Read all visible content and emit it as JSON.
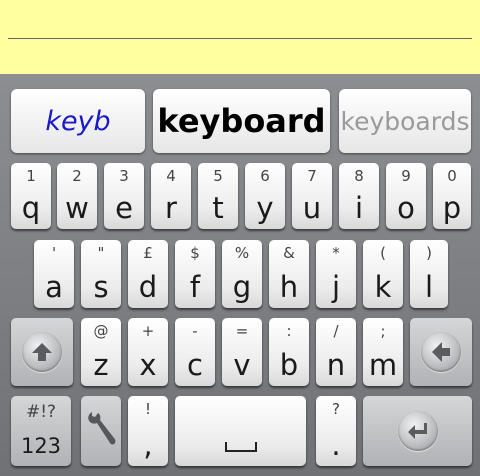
{
  "suggestions": {
    "typed": "keyb",
    "primary": "keyboard",
    "alternate": "keyboards"
  },
  "rows": {
    "row1": [
      {
        "hint": "1",
        "label": "q"
      },
      {
        "hint": "2",
        "label": "w"
      },
      {
        "hint": "3",
        "label": "e"
      },
      {
        "hint": "4",
        "label": "r"
      },
      {
        "hint": "5",
        "label": "t"
      },
      {
        "hint": "6",
        "label": "y"
      },
      {
        "hint": "7",
        "label": "u"
      },
      {
        "hint": "8",
        "label": "i"
      },
      {
        "hint": "9",
        "label": "o"
      },
      {
        "hint": "0",
        "label": "p"
      }
    ],
    "row2": [
      {
        "hint": "'",
        "label": "a"
      },
      {
        "hint": "\"",
        "label": "s"
      },
      {
        "hint": "£",
        "label": "d"
      },
      {
        "hint": "$",
        "label": "f"
      },
      {
        "hint": "%",
        "label": "g"
      },
      {
        "hint": "&",
        "label": "h"
      },
      {
        "hint": "*",
        "label": "j"
      },
      {
        "hint": "(",
        "label": "k"
      },
      {
        "hint": ")",
        "label": "l"
      }
    ],
    "row3": [
      {
        "hint": "@",
        "label": "z"
      },
      {
        "hint": "+",
        "label": "x"
      },
      {
        "hint": "-",
        "label": "c"
      },
      {
        "hint": "=",
        "label": "v"
      },
      {
        "hint": ":",
        "label": "b"
      },
      {
        "hint": "/",
        "label": "n"
      },
      {
        "hint": ";",
        "label": "m"
      }
    ]
  },
  "bottom": {
    "symbols_hint": "#!?",
    "symbols_label": "123",
    "comma_hint": "!",
    "comma_label": ",",
    "period_hint": "?",
    "period_label": "."
  },
  "icons": {
    "shift": "shift-arrow-up-icon",
    "delete": "backspace-arrow-left-icon",
    "settings": "wrench-icon",
    "enter": "enter-return-icon",
    "space": "space-bar-icon"
  },
  "colors": {
    "text_area": "#ffff9f",
    "typed_suggestion": "#1a1ac8",
    "alternate_suggestion": "#9a9a9a"
  }
}
